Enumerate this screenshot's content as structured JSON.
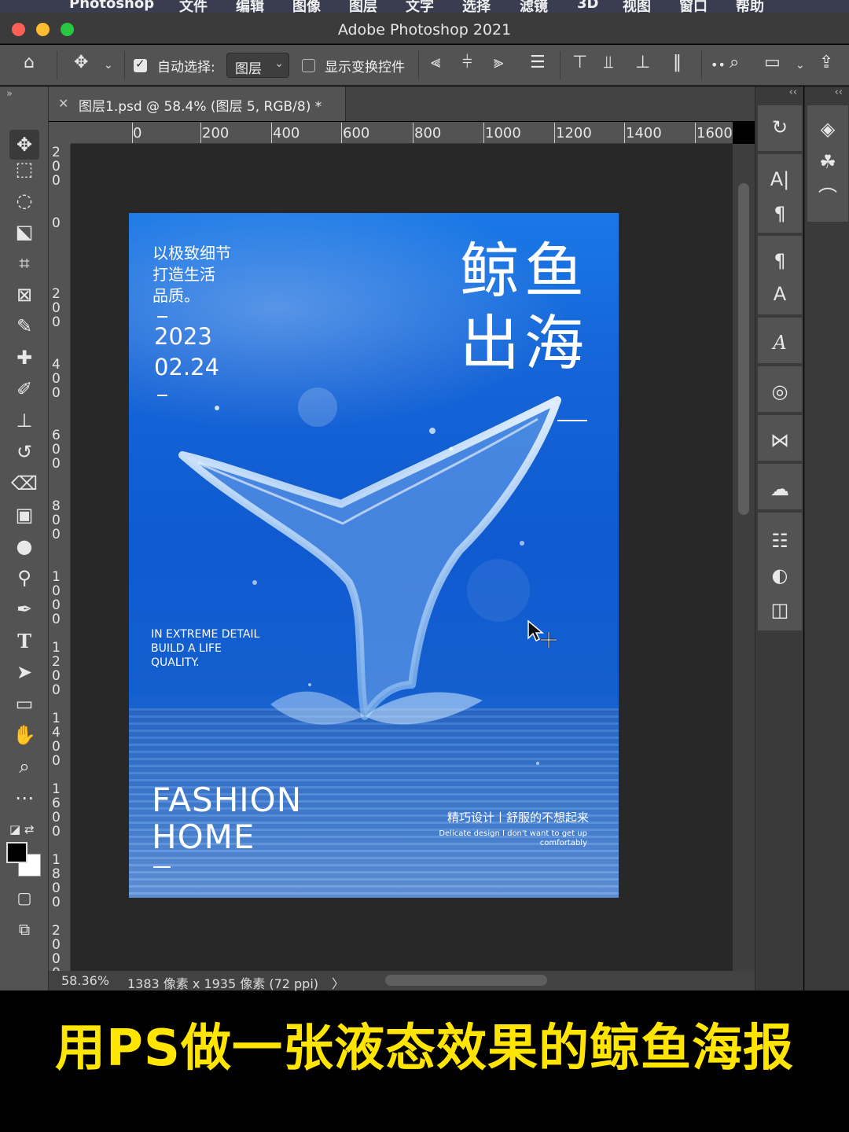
{
  "menubar": {
    "items": [
      "Photoshop",
      "文件",
      "编辑",
      "图像",
      "图层",
      "文字",
      "选择",
      "滤镜",
      "3D",
      "视图",
      "窗口",
      "帮助"
    ]
  },
  "window": {
    "title": "Adobe Photoshop 2021"
  },
  "options_bar": {
    "auto_select_label": "自动选择:",
    "auto_select_checked": true,
    "auto_select_target": "图层",
    "show_transform_label": "显示变换控件",
    "show_transform_checked": false
  },
  "document_tab": {
    "name": "图层1.psd @ 58.4% (图层 5, RGB/8) *"
  },
  "rulers": {
    "top": [
      "0",
      "200",
      "400",
      "600",
      "800",
      "1000",
      "1200",
      "1400",
      "1600"
    ],
    "left": [
      "200",
      "0",
      "200",
      "400",
      "600",
      "800",
      "1000",
      "1200",
      "1400",
      "1600",
      "1800",
      "2000"
    ]
  },
  "status_bar": {
    "zoom": "58.36%",
    "dimensions": "1383 像素 x 1935 像素 (72 ppi)",
    "arrow": "〉"
  },
  "poster": {
    "intro_cn": [
      "以极致细节",
      "打造生活",
      "品质。"
    ],
    "year": "2023",
    "date": "02.24",
    "title_cn": [
      "鲸鱼",
      "出海"
    ],
    "intro_en": [
      "IN EXTREME DETAIL",
      "BUILD A LIFE",
      "QUALITY."
    ],
    "brand": [
      "FASHION",
      "HOME"
    ],
    "tagline_cn": "精巧设计丨舒服的不想起来",
    "tagline_en": [
      "Delicate design I don't want to get up",
      "comfortably"
    ]
  },
  "caption": {
    "text": "用PS做一张液态效果的鲸鱼海报",
    "color": "#ffe500"
  },
  "colors": {
    "foreground": "#000000",
    "background": "#ffffff",
    "poster_blue": "#1565d8"
  },
  "icons": {
    "tools": [
      "move-icon",
      "marquee-icon",
      "lasso-icon",
      "object-select-icon",
      "crop-icon",
      "frame-icon",
      "eyedropper-icon",
      "healing-brush-icon",
      "brush-icon",
      "stamp-icon",
      "history-brush-icon",
      "eraser-icon",
      "gradient-icon",
      "blur-icon",
      "dodge-icon",
      "pen-icon",
      "type-icon",
      "path-select-icon",
      "rectangle-icon",
      "hand-icon",
      "zoom-icon",
      "more-icon"
    ],
    "panels": [
      "history-icon",
      "character-icon",
      "paragraph-icon",
      "paragraph-style-icon",
      "character-style-icon",
      "glyphs-icon",
      "styles-icon",
      "shapes-icon",
      "swatches-icon",
      "adjustments-icon",
      "properties-icon",
      "libraries-icon",
      "layers-icon",
      "channels-icon",
      "paths-icon"
    ]
  }
}
